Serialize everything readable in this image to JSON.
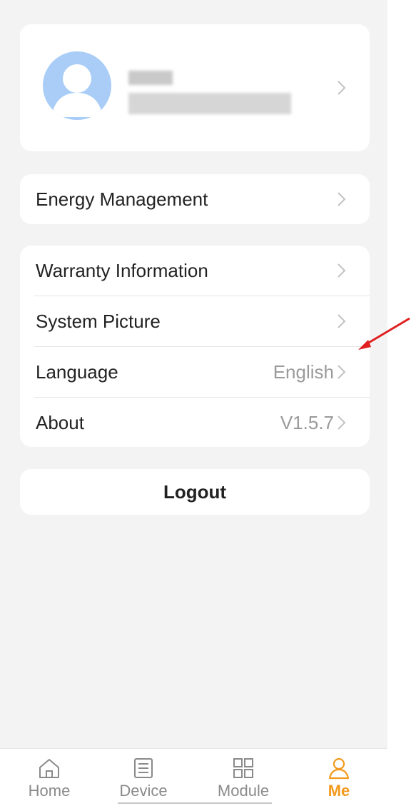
{
  "profile": {
    "chevron_icon": "chevron-right-icon",
    "avatar_icon": "user-avatar-icon"
  },
  "energy": {
    "label": "Energy Management"
  },
  "menu": {
    "items": [
      {
        "label": "Warranty Information",
        "value": ""
      },
      {
        "label": "System Picture",
        "value": ""
      },
      {
        "label": "Language",
        "value": "English"
      },
      {
        "label": "About",
        "value": "V1.5.7"
      }
    ]
  },
  "logout": {
    "label": "Logout"
  },
  "tabbar": {
    "tabs": [
      {
        "label": "Home",
        "icon": "home-icon"
      },
      {
        "label": "Device",
        "icon": "device-list-icon"
      },
      {
        "label": "Module",
        "icon": "module-grid-icon"
      },
      {
        "label": "Me",
        "icon": "person-icon",
        "active": true
      }
    ]
  },
  "colors": {
    "accent": "#f39a1e",
    "background": "#f3f3f3",
    "avatar": "#a9cdf7",
    "annotation_arrow": "#e02020"
  }
}
